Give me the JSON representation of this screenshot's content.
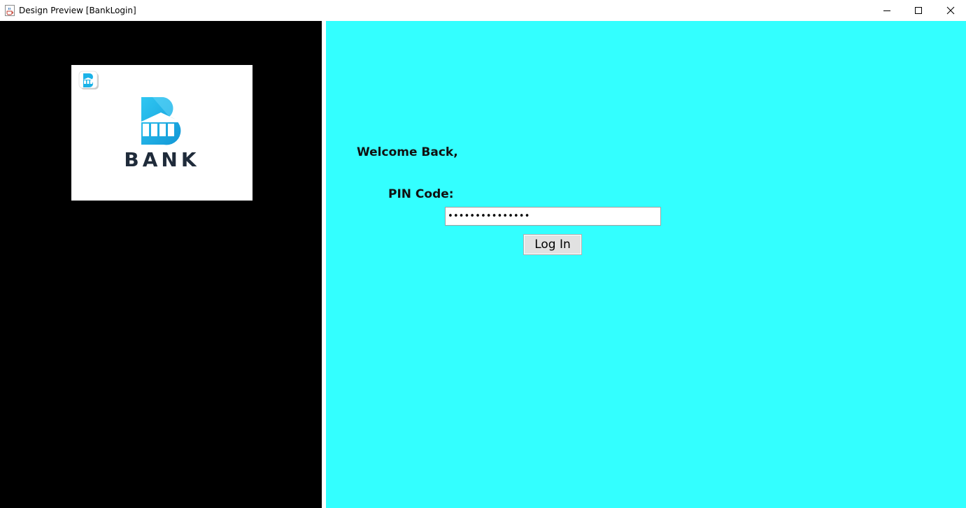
{
  "window": {
    "title": "Design Preview [BankLogin]",
    "icons": {
      "app": "java-cup-icon",
      "minimize": "minimize-icon",
      "maximize": "maximize-icon",
      "close": "close-icon"
    }
  },
  "logo": {
    "word": "BANK",
    "brand_color": "#1ab2e8",
    "text_color": "#1f2b3a"
  },
  "login": {
    "welcome": "Welcome Back,",
    "pin_label": "PIN Code:",
    "pin_value": "•••••••••••••••",
    "button_label": "Log In"
  },
  "colors": {
    "left_panel": "#000000",
    "right_panel": "#33ffff"
  }
}
